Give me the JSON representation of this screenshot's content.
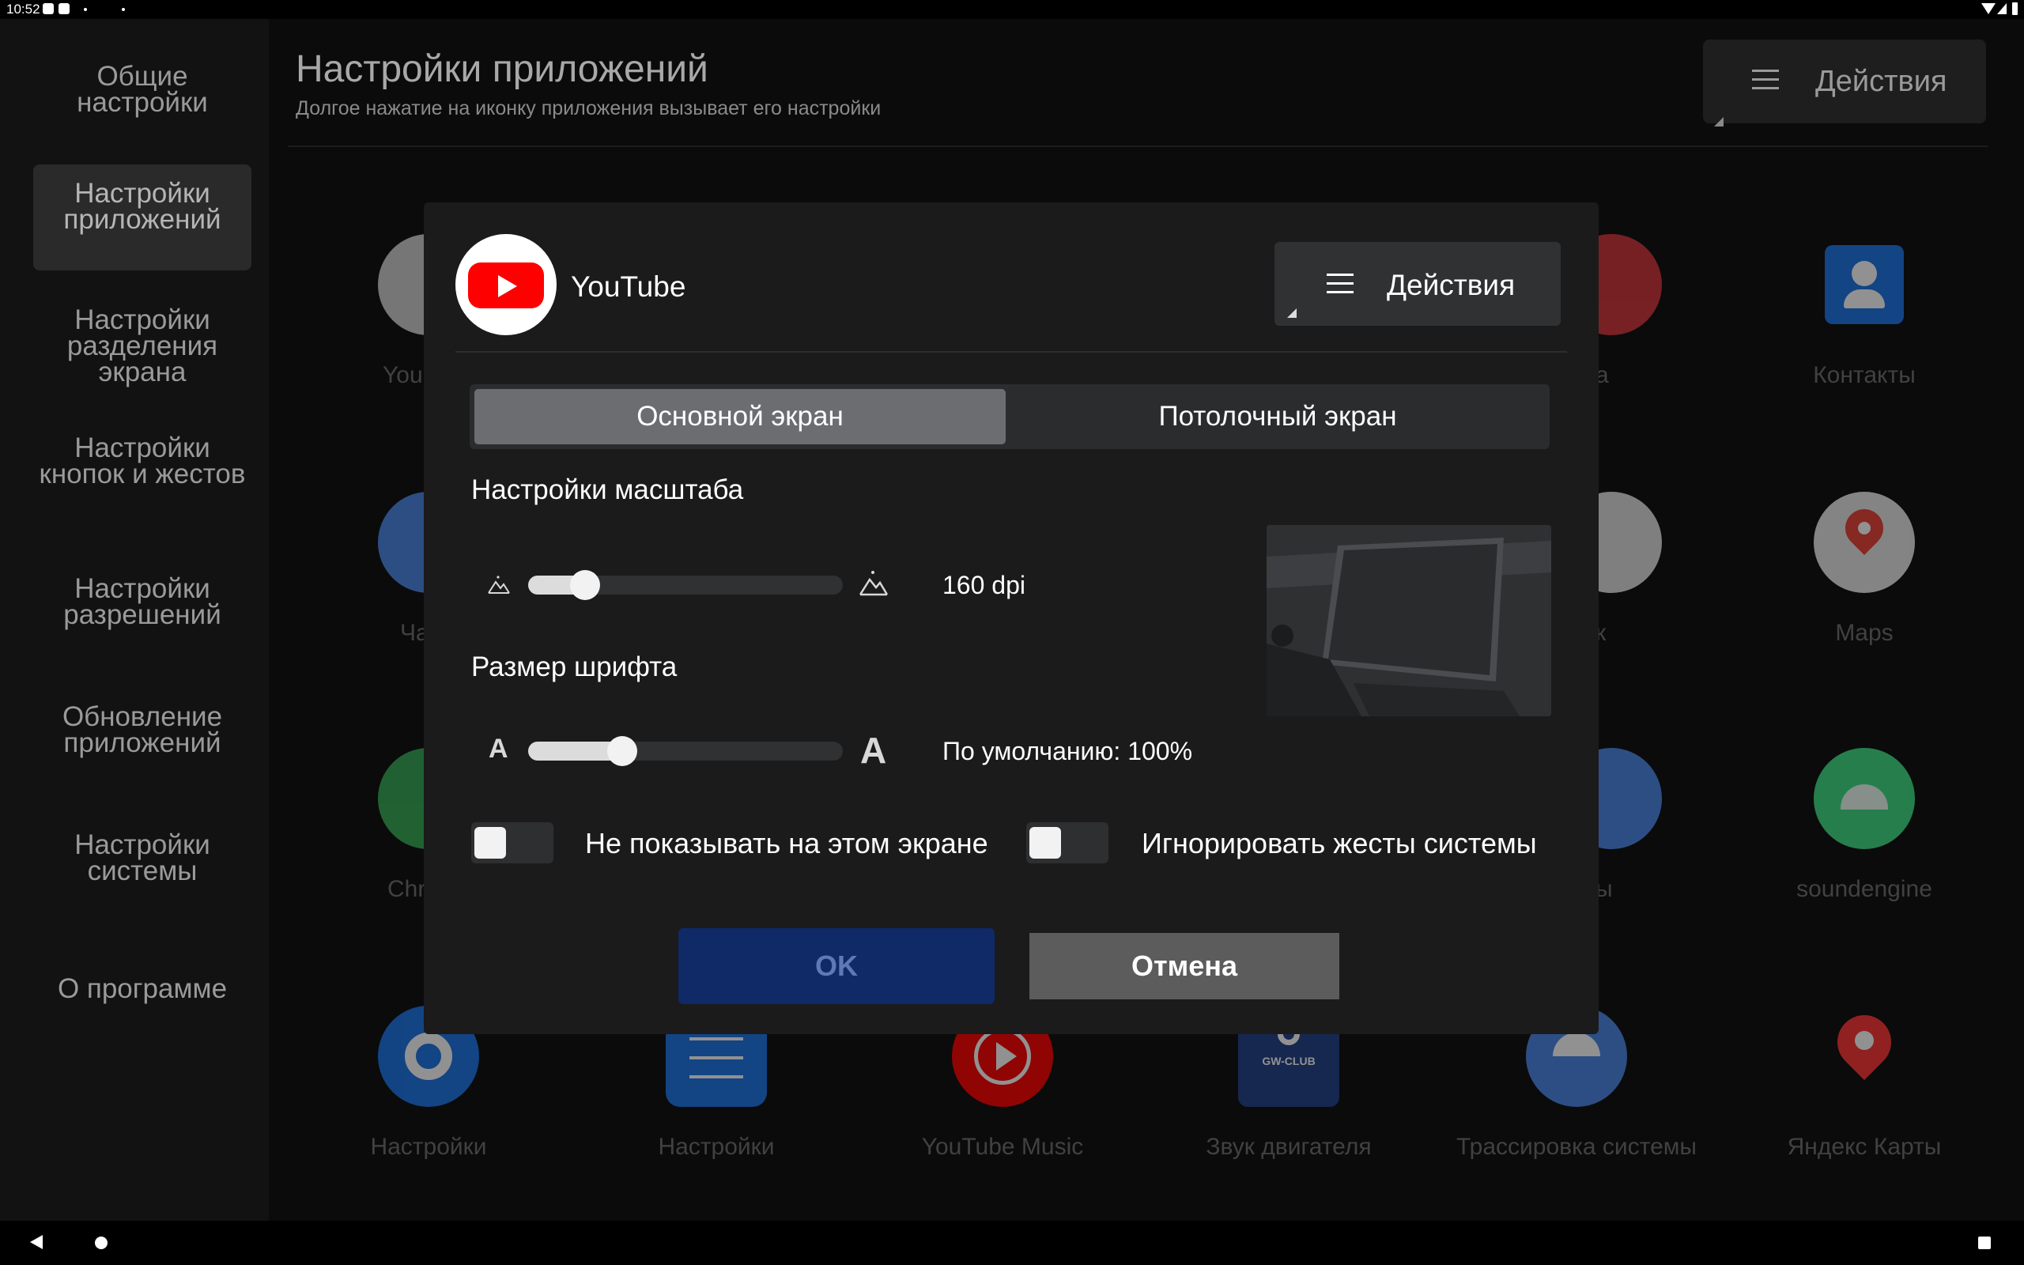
{
  "status_bar": {
    "time": "10:52"
  },
  "sidebar": {
    "items": [
      {
        "label": "Общие настройки",
        "active": false
      },
      {
        "label": "Настройки приложений",
        "active": true
      },
      {
        "label": "Настройки разделения экрана",
        "active": false
      },
      {
        "label": "Настройки кнопок и жестов",
        "active": false
      },
      {
        "label": "Настройки разрешений",
        "active": false
      },
      {
        "label": "Обновление приложений",
        "active": false
      },
      {
        "label": "Настройки системы",
        "active": false
      },
      {
        "label": "О программе",
        "active": false
      }
    ]
  },
  "header": {
    "title": "Настройки приложений",
    "subtitle": "Долгое нажатие на иконку приложения вызывает его настройки",
    "actions_label": "Действия"
  },
  "apps_visible": {
    "row1": [
      "You",
      "а",
      "Контакты"
    ],
    "row2": [
      "Ча",
      "к",
      "Maps"
    ],
    "row3": [
      "Chr",
      "ы",
      "soundengine"
    ],
    "row4": [
      "Настройки",
      "Настройки",
      "YouTube Music",
      "Звук двигателя",
      "Трассировка системы",
      "Яндекс Карты"
    ],
    "gw_club_text": "GW-CLUB"
  },
  "dialog": {
    "app_name": "YouTube",
    "actions_label": "Действия",
    "tabs": [
      {
        "label": "Основной экран",
        "active": true
      },
      {
        "label": "Потолочный экран",
        "active": false
      }
    ],
    "scale": {
      "label": "Настройки масштаба",
      "value_text": "160 dpi",
      "slider_fraction": 0.18
    },
    "font": {
      "label": "Размер шрифта",
      "value_text": "По умолчанию: 100%",
      "slider_fraction": 0.3,
      "small_glyph": "A",
      "large_glyph": "A"
    },
    "toggle_hide": {
      "label": "Не показывать на этом экране",
      "on": false
    },
    "toggle_gestures": {
      "label": "Игнорировать жесты системы",
      "on": false
    },
    "ok_label": "OK",
    "cancel_label": "Отмена"
  },
  "colors": {
    "youtube_red": "#ff0000",
    "ok_bg": "#0f2a66",
    "cancel_bg": "#5c5c5d",
    "dialog_bg": "#1b1b1c"
  }
}
